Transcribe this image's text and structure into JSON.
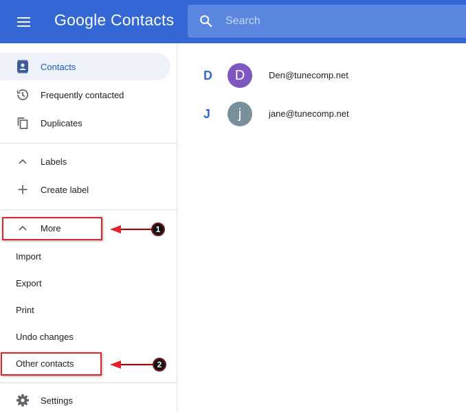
{
  "header": {
    "title": "Google Contacts",
    "search": {
      "placeholder": "Search",
      "value": ""
    },
    "brand_color": "#3367d6"
  },
  "sidebar": {
    "items": [
      {
        "label": "Contacts",
        "icon": "contacts-card-icon",
        "active": true
      },
      {
        "label": "Frequently contacted",
        "icon": "history-icon"
      },
      {
        "label": "Duplicates",
        "icon": "copy-icon"
      }
    ],
    "labels_section": {
      "label": "Labels",
      "icon": "chevron-up-icon",
      "create_label": "Create label",
      "create_icon": "plus-icon"
    },
    "more_section": {
      "label": "More",
      "icon": "chevron-up-icon",
      "items": [
        "Import",
        "Export",
        "Print",
        "Undo changes",
        "Other contacts"
      ]
    },
    "settings": {
      "label": "Settings",
      "icon": "gear-icon"
    }
  },
  "annotations": [
    {
      "number": "1",
      "target": "More"
    },
    {
      "number": "2",
      "target": "Other contacts"
    }
  ],
  "contacts": [
    {
      "letter": "D",
      "initial": "D",
      "email": "Den@tunecomp.net",
      "avatar_color": "#7e57c2"
    },
    {
      "letter": "J",
      "initial": "j",
      "email": "jane@tunecomp.net",
      "avatar_color": "#78909c"
    }
  ]
}
